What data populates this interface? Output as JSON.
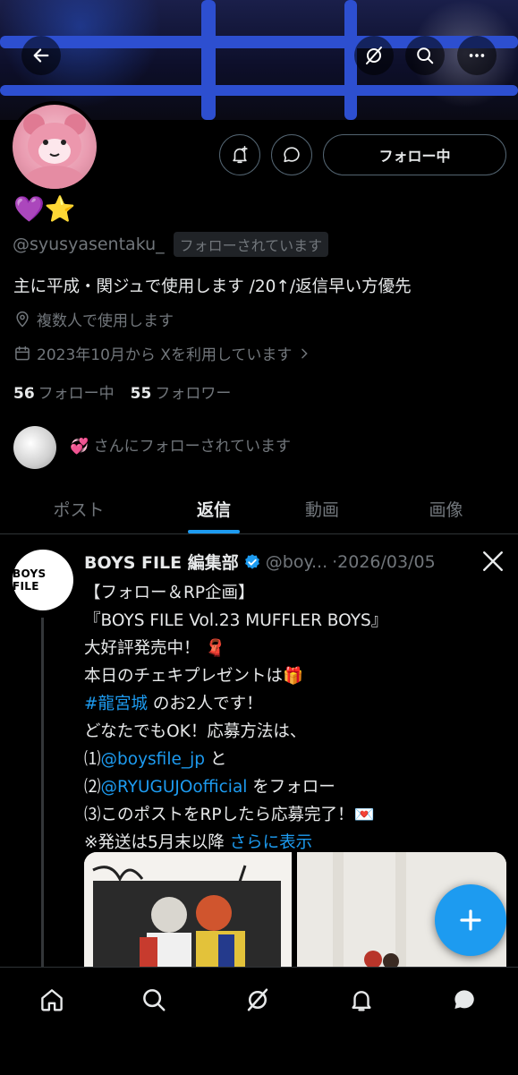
{
  "header": {
    "back_icon": "arrow-left-icon",
    "grok_icon": "grok-slash-icon",
    "search_icon": "search-icon",
    "more_icon": "ellipsis-icon"
  },
  "profile": {
    "name": "💜⭐",
    "handle": "@syusyasentaku_",
    "follows_you_badge": "フォローされています",
    "following_button": "フォロー中",
    "bio": "主に平成・関ジュで使用します /20↑/返信早い方優先",
    "location": "複数人で使用します",
    "joined": "2023年10月から Xを利用しています",
    "following_count": "56",
    "following_label": "フォロー中",
    "followers_count": "55",
    "followers_label": "フォロワー",
    "followed_by_text": "💞 さんにフォローされています"
  },
  "tabs": [
    {
      "label": "ポスト"
    },
    {
      "label": "返信"
    },
    {
      "label": "動画"
    },
    {
      "label": "画像"
    }
  ],
  "post": {
    "author_name": "BOYS FILE 編集部",
    "author_avatar_text": "BOYS FILE",
    "author_handle": "@boy...",
    "date": "·2026/03/05",
    "lines": {
      "l1": "【フォロー＆RP企画】",
      "l2": "『BOYS FILE Vol.23 MUFFLER BOYS』",
      "l3": "大好評発売中！ 🧣",
      "l4": "本日のチェキプレゼントは🎁",
      "l5_link": "#龍宮城",
      "l5_rest": " のお2人です！",
      "l6": "どなたでもOK！応募方法は、",
      "l7_pre": "⑴",
      "l7_link": "@boysfile_jp",
      "l7_rest": " と",
      "l8_pre": "⑵",
      "l8_link": "@RYUGUJOofficial",
      "l8_rest": " をフォロー",
      "l9": "⑶このポストをRPしたら応募完了！💌",
      "l10": "※発送は5月末以降",
      "show_more": "さらに表示"
    }
  },
  "fab": {
    "icon": "plus-icon"
  },
  "bottom_nav": [
    "home-icon",
    "search-icon",
    "grok-icon",
    "notifications-icon",
    "messages-icon"
  ],
  "colors": {
    "accent": "#1d9bf0",
    "background": "#000000",
    "muted": "#71767b"
  }
}
